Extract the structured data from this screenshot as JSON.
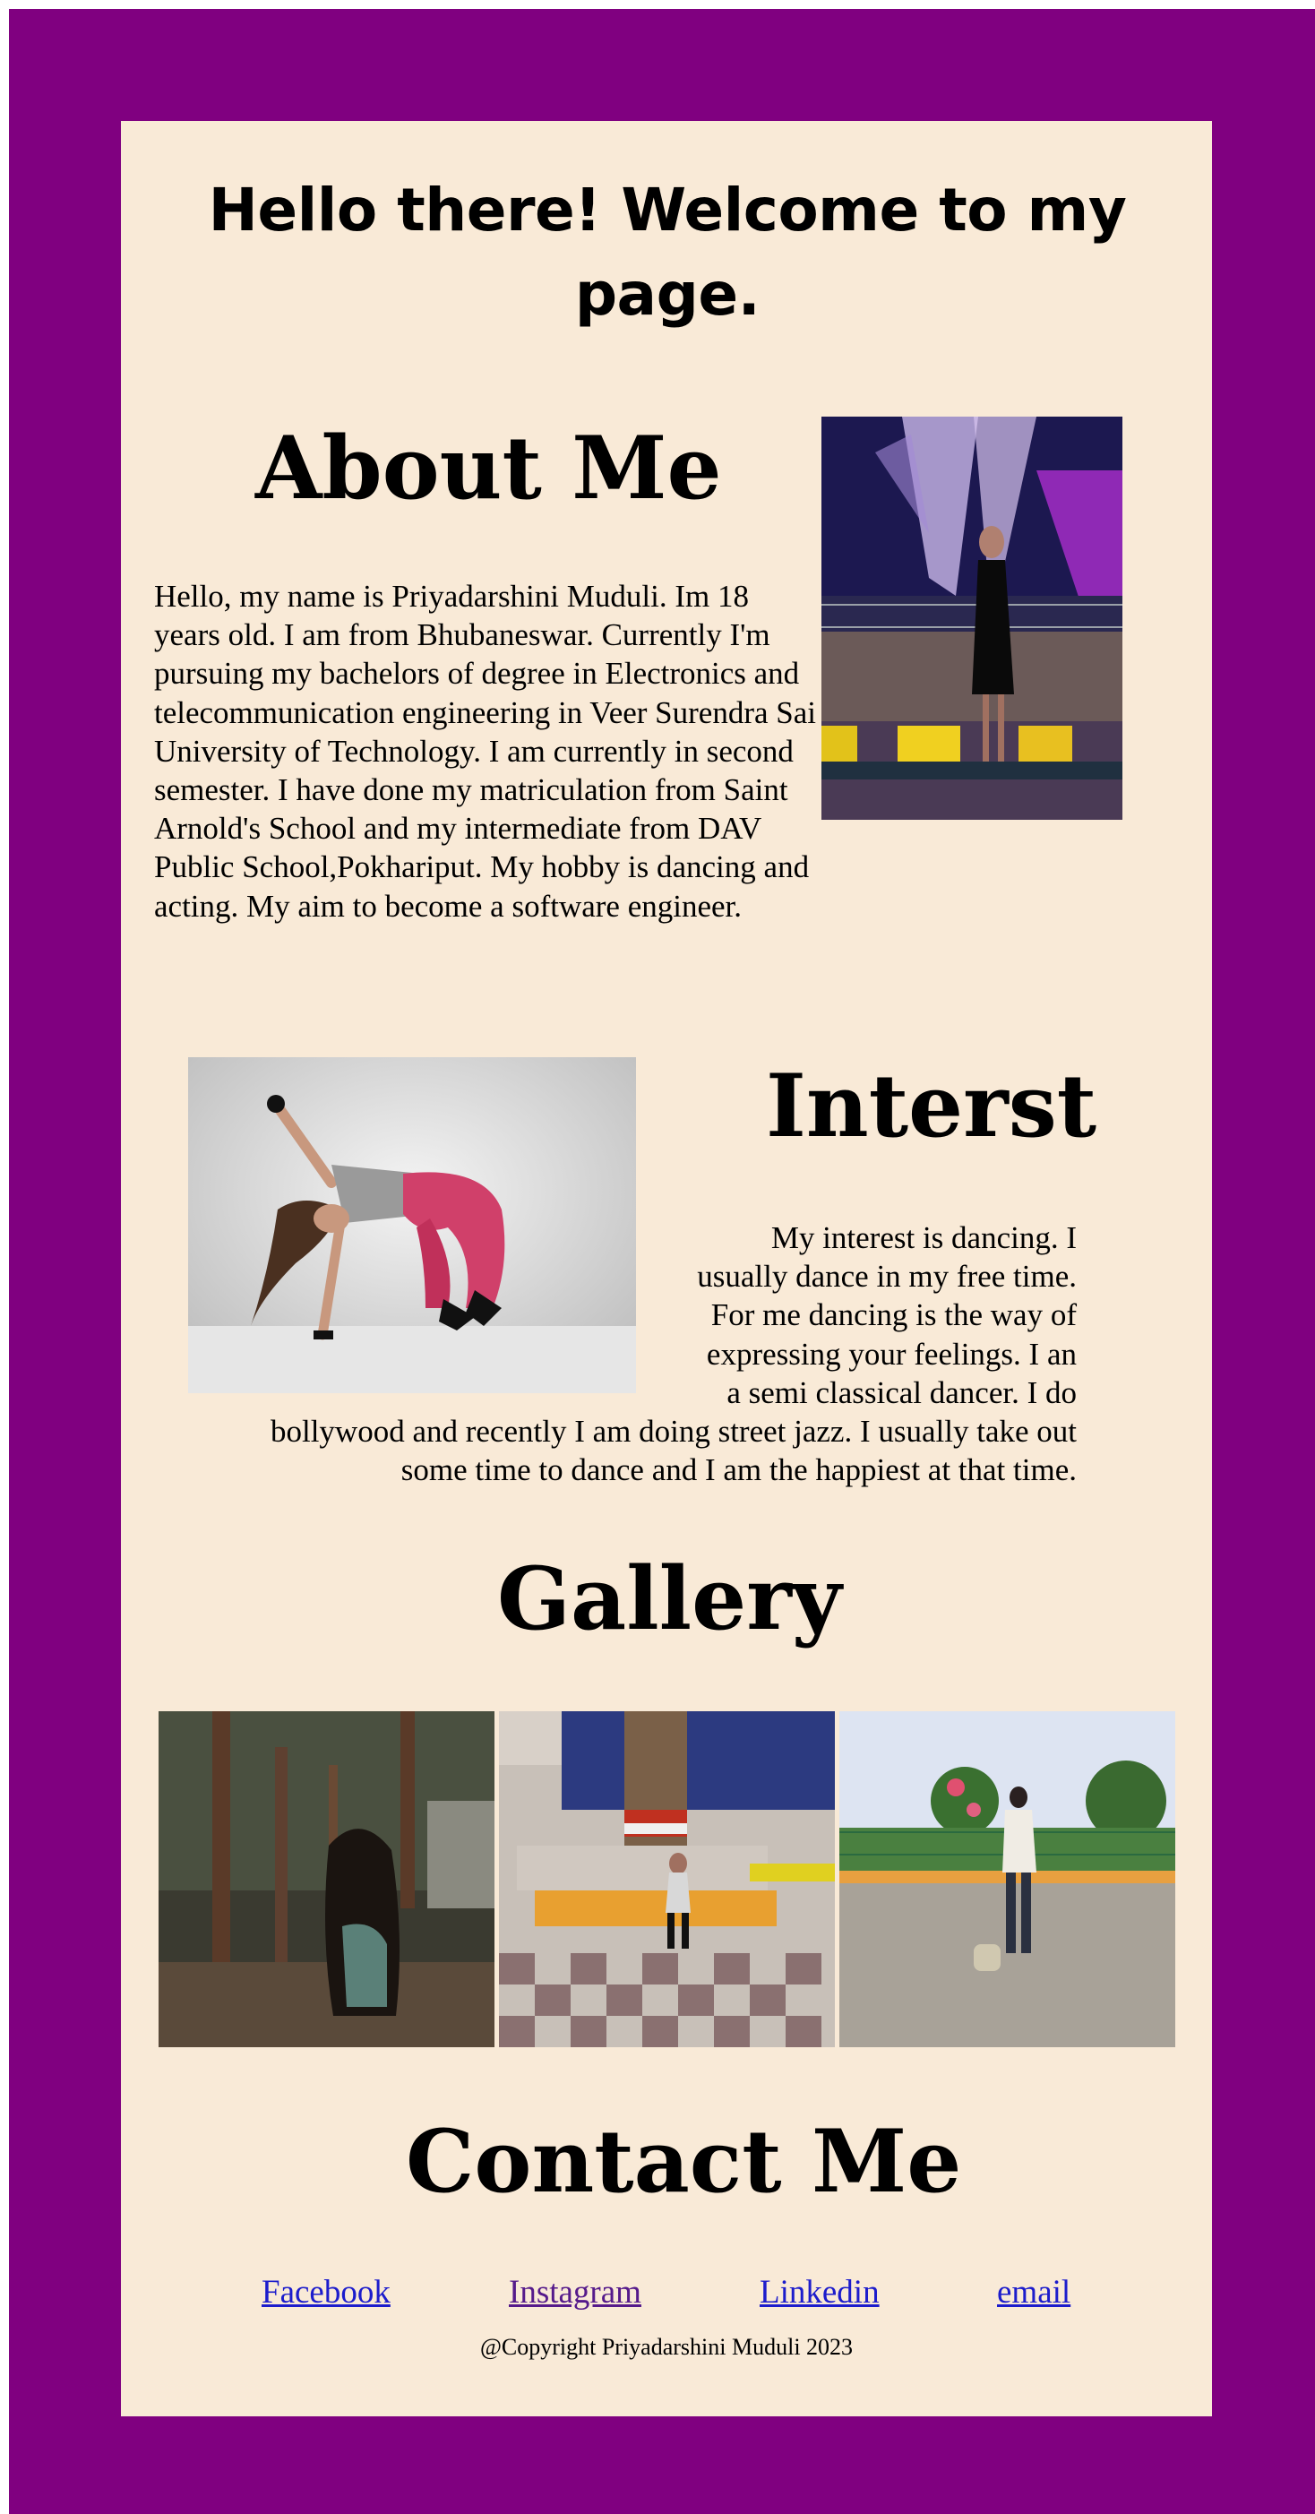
{
  "header": {
    "welcome": "Hello there! Welcome to my page."
  },
  "about": {
    "title": "About Me",
    "text": "Hello, my name is Priyadarshini Muduli. Im 18 years old. I am from Bhubaneswar. Currently I'm pursuing my bachelors of degree in Electronics and telecommunication engineering in Veer Surendra Sai University of Technology. I am currently in second semester. I have done my matriculation from Saint Arnold's School and my intermediate from DAV Public School,Pokhariput. My hobby is dancing and acting. My aim to become a software engineer."
  },
  "interest": {
    "title": "Interst",
    "lines": [
      "My interest is dancing. I",
      "usually dance in my free time.",
      "For me dancing is the way of",
      "expressing your feelings. I an",
      "a semi classical dancer. I do",
      "bollywood and recently I am doing street jazz. I usually take out",
      "some time to dance and I am the happiest at that time."
    ]
  },
  "gallery": {
    "title": "Gallery"
  },
  "contact": {
    "title": "Contact Me",
    "links": [
      "Facebook",
      "Instagram",
      "Linkedin",
      "email"
    ],
    "copyright": "@Copyright Priyadarshini Muduli 2023"
  },
  "colors": {
    "frame": "#800080",
    "card": "#f9ead7",
    "link": "#1c1ccc",
    "visited_link": "#551a8b"
  }
}
